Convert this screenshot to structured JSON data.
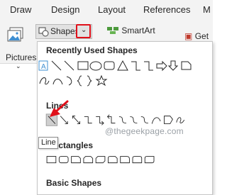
{
  "tabs": [
    "Draw",
    "Design",
    "Layout",
    "References",
    "M"
  ],
  "ribbon": {
    "pictures_label": "Pictures",
    "shapes_label": "Shapes",
    "smartart_label": "SmartArt",
    "get_addins_label": "Get A"
  },
  "shapes_menu": {
    "recent_title": "Recently Used Shapes",
    "lines_title": "Lines",
    "rectangles_title": "Rectangles",
    "basic_title": "Basic Shapes"
  },
  "tooltip": "Line",
  "watermark": "@thegeekpage.com",
  "colors": {
    "highlight_red": "#e0101a",
    "shape_stroke": "#262626",
    "selected_line_bg": "#cfcfcf"
  }
}
